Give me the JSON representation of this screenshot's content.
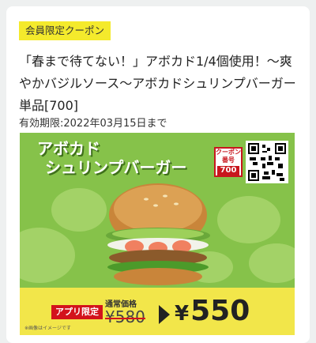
{
  "coupon": {
    "badge": "会員限定クーポン",
    "title": "「春まで待てない！」アボカド1/4個使用！～爽やかバジルソース～アボカドシュリンプバーガー単品[700]",
    "expiry": "有効期限:2022年03月15日まで"
  },
  "banner": {
    "product_name_line1": "アボカド",
    "product_name_line2": "シュリンプバーガー",
    "coupon_label": "クーポン番号",
    "coupon_number": "700",
    "app_only": "アプリ限定",
    "regular_price_label": "通常価格",
    "regular_price": "¥580",
    "sale_currency": "¥",
    "sale_price": "550",
    "fineprint": "※画像はイメージです"
  },
  "colors": {
    "badge_bg": "#f4ea2c",
    "banner_green": "#86c24a",
    "price_bar": "#f2e64a",
    "accent_red": "#d3131c"
  }
}
